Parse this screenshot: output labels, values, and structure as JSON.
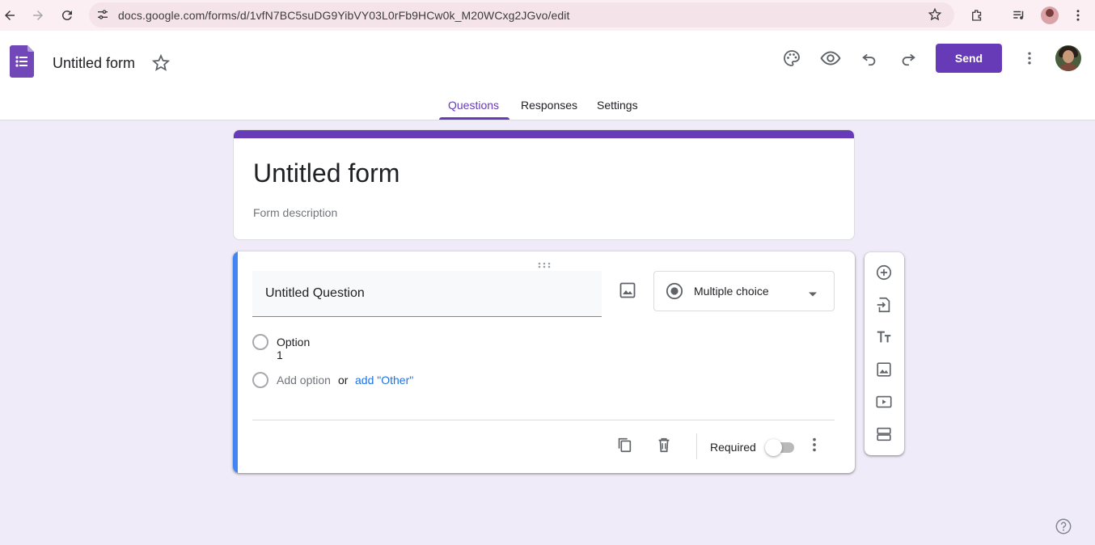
{
  "browser": {
    "url": "docs.google.com/forms/d/1vfN7BC5suDG9YibVY03L0rFb9HCw0k_M20WCxg2JGvo/edit"
  },
  "header": {
    "doc_title": "Untitled form",
    "send_label": "Send",
    "accent_color": "#673ab7"
  },
  "tabs": [
    {
      "label": "Questions",
      "active": true
    },
    {
      "label": "Responses",
      "active": false
    },
    {
      "label": "Settings",
      "active": false
    }
  ],
  "form": {
    "title": "Untitled form",
    "description_placeholder": "Form description"
  },
  "question": {
    "title": "Untitled Question",
    "type": "Multiple choice",
    "options": [
      "Option 1"
    ],
    "add_option_label": "Add option",
    "or_label": "or",
    "add_other_label": "add \"Other\"",
    "required_label": "Required",
    "required": false
  },
  "side_toolbar": {
    "icons": [
      "add-question-icon",
      "import-questions-icon",
      "add-title-icon",
      "add-image-icon",
      "add-video-icon",
      "add-section-icon"
    ]
  }
}
